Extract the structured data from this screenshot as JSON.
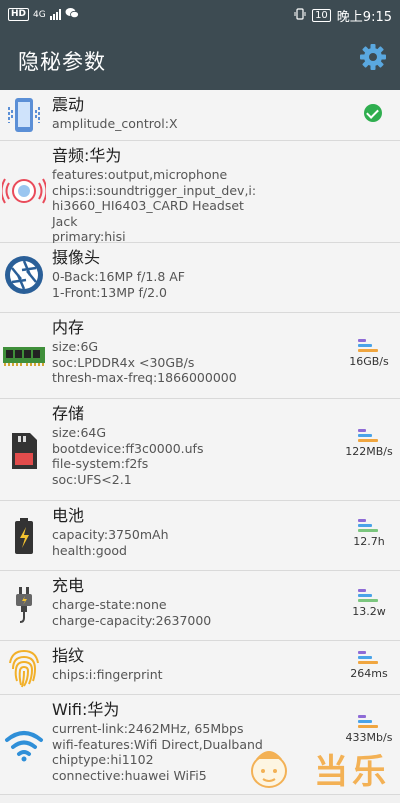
{
  "status_bar": {
    "left_badge": "HD",
    "network": "4G",
    "battery": "10",
    "time": "晚上9:15"
  },
  "app_bar": {
    "title": "隐秘参数",
    "settings_icon": "gear-icon"
  },
  "items": [
    {
      "name": "震动",
      "detail": "amplitude_control:X",
      "icon": "vibrate-phone-icon",
      "status": "ok"
    },
    {
      "name": "音频:华为",
      "detail": "features:output,microphone\nchips:i:soundtrigger_input_dev,i:\nhi3660_HI6403_CARD Headset\nJack\nprimary:hisi",
      "icon": "audio-speaker-icon"
    },
    {
      "name": "摄像头",
      "detail": "0-Back:16MP f/1.8 AF\n1-Front:13MP f/2.0",
      "icon": "camera-aperture-icon"
    },
    {
      "name": "内存",
      "detail": "size:6G\nsoc:LPDDR4x <30GB/s\nthresh-max-freq:1866000000",
      "icon": "memory-chip-icon",
      "metric": "16GB/s"
    },
    {
      "name": "存储",
      "detail": "size:64G\nbootdevice:ff3c0000.ufs\nfile-system:f2fs\nsoc:UFS<2.1",
      "icon": "sd-card-icon",
      "metric": "122MB/s"
    },
    {
      "name": "电池",
      "detail": "capacity:3750mAh\nhealth:good",
      "icon": "battery-icon",
      "metric": "12.7h"
    },
    {
      "name": "充电",
      "detail": "charge-state:none\ncharge-capacity:2637000",
      "icon": "charger-plug-icon",
      "metric": "13.2w"
    },
    {
      "name": "指纹",
      "detail": "chips:i:fingerprint",
      "icon": "fingerprint-icon",
      "metric": "264ms"
    },
    {
      "name": "Wifi:华为",
      "detail": "current-link:2462MHz, 65Mbps\nwifi-features:Wifi Direct,Dualband\nchiptype:hi1102\nconnective:huawei WiFi5",
      "icon": "wifi-icon",
      "metric": "433Mb/s"
    }
  ],
  "watermark": {
    "text": "当乐"
  },
  "colors": {
    "bar_bg": "#3d4b52",
    "gear": "#5aa8e0",
    "ok_green": "#2fae4f",
    "mini_bars": [
      "#8e6bd6",
      "#4aa3e8",
      "#f0a640",
      "#7bc67e"
    ]
  }
}
